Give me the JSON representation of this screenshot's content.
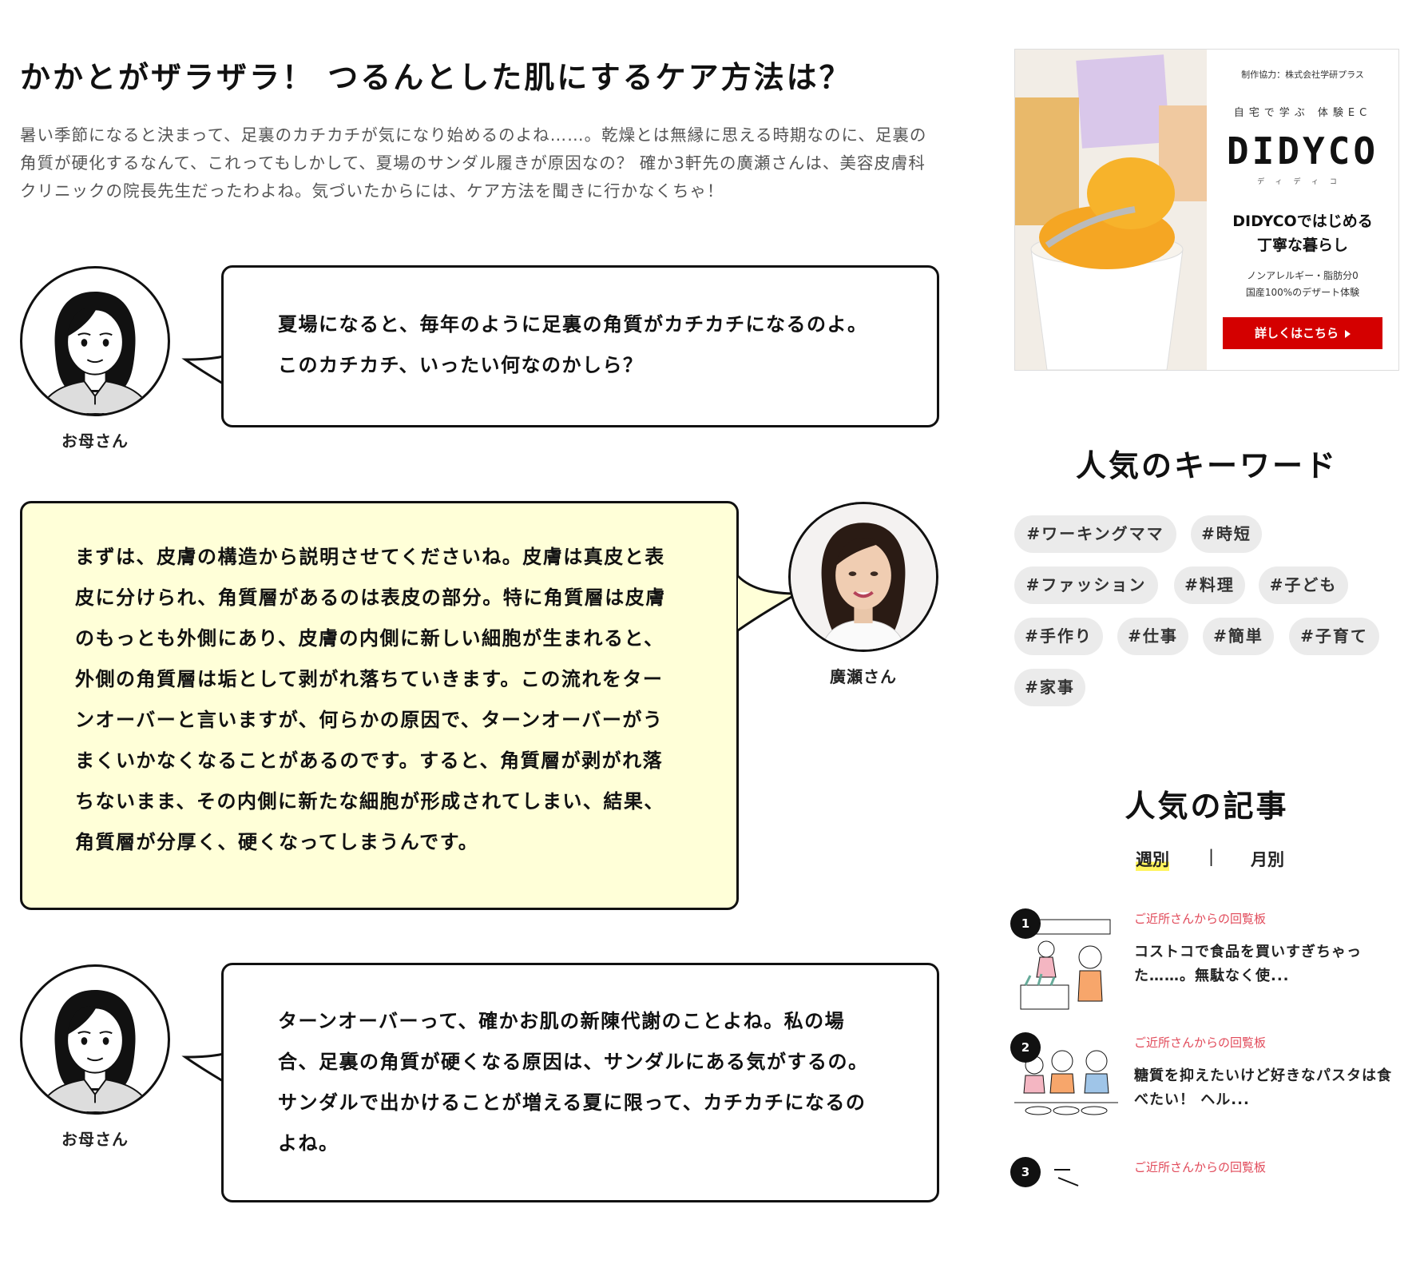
{
  "article": {
    "title": "かかとがザラザラ！ つるんとした肌にするケア方法は？",
    "intro": "暑い季節になると決まって、足裏のカチカチが気になり始めるのよね……。乾燥とは無縁に思える時期なのに、足裏の角質が硬化するなんて、これってもしかして、夏場のサンダル履きが原因なの？ 確か3軒先の廣瀬さんは、美容皮膚科クリニックの院長先生だったわよね。気づいたからには、ケア方法を聞きに行かなくちゃ！",
    "dialogs": [
      {
        "speaker": "お母さん",
        "lines": [
          "夏場になると、毎年のように足裏の角質がカチカチになるのよ。",
          "このカチカチ、いったい何なのかしら？"
        ]
      },
      {
        "speaker": "廣瀬さん",
        "lines": [
          "まずは、皮膚の構造から説明させてくださいね。皮膚は真皮と表",
          "皮に分けられ、角質層があるのは表皮の部分。特に角質層は皮膚",
          "のもっとも外側にあり、皮膚の内側に新しい細胞が生まれると、",
          "外側の角質層は垢として剥がれ落ちていきます。この流れをター",
          "ンオーバーと言いますが、何らかの原因で、ターンオーバーがう",
          "まくいかなくなることがあるのです。すると、角質層が剥がれ落",
          "ちないまま、その内側に新たな細胞が形成されてしまい、結果、",
          "角質層が分厚く、硬くなってしまうんです。"
        ]
      },
      {
        "speaker": "お母さん",
        "lines": [
          "ターンオーバーって、確かお肌の新陳代謝のことよね。私の場",
          "合、足裏の角質が硬くなる原因は、サンダルにある気がするの。",
          "サンダルで出かけることが増える夏に限って、カチカチになるの",
          "よね。"
        ]
      }
    ]
  },
  "ad": {
    "credit": "制作協力：株式会社学研プラス",
    "tagline": "自宅で学ぶ 体験EC",
    "logo": "DIDYCO",
    "logo_reading": "ディディコ",
    "headline_1": "DIDYCOではじめる",
    "headline_2": "丁寧な暮らし",
    "desc_1": "ノンアレルギー・脂肪分0",
    "desc_2": "国産100%のデザート体験",
    "button": "詳しくはこちら"
  },
  "keywords": {
    "title": "人気のキーワード",
    "tags": [
      "#ワーキングママ",
      "#時短",
      "#ファッション",
      "#料理",
      "#子ども",
      "#手作り",
      "#仕事",
      "#簡単",
      "#子育て",
      "#家事"
    ]
  },
  "popular": {
    "title": "人気の記事",
    "tab_weekly": "週別",
    "tab_separator": "|",
    "tab_monthly": "月別",
    "items": [
      {
        "rank": "1",
        "category": "ご近所さんからの回覧板",
        "text": "コストコで食品を買いすぎちゃった……。無駄なく使..."
      },
      {
        "rank": "2",
        "category": "ご近所さんからの回覧板",
        "text": "糖質を抑えたいけど好きなパスタは食べたい！ ヘル..."
      },
      {
        "rank": "3",
        "category": "ご近所さんからの回覧板",
        "text": ""
      }
    ]
  },
  "colors": {
    "ad_button": "#d40000",
    "category": "#e14a5a",
    "yellow_bubble": "#ffffd8",
    "tab_highlight": "#fff45c"
  }
}
